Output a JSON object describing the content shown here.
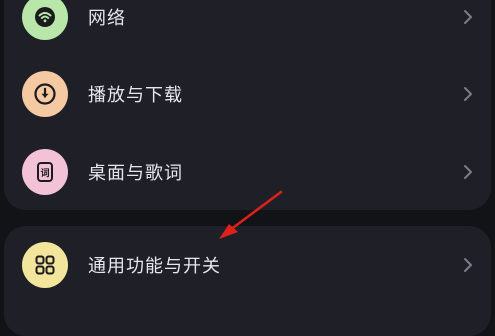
{
  "colors": {
    "background": "#121317",
    "card": "#1f2027",
    "text": "#e6e7ec",
    "chevron": "#7b7d86",
    "icon_network_bg": "#b9e7a9",
    "icon_download_bg": "#f5c9a1",
    "icon_desktop_lyrics_bg": "#f3c2d7",
    "icon_general_bg": "#f3e59b",
    "icon_glyph": "#1b1b1f",
    "annotation_arrow": "#e0211b"
  },
  "settings": {
    "group1": [
      {
        "label": "网络",
        "icon": "wifi-icon"
      },
      {
        "label": "播放与下载",
        "icon": "download-icon"
      },
      {
        "label": "桌面与歌词",
        "icon": "lyrics-icon"
      }
    ],
    "group2": [
      {
        "label": "通用功能与开关",
        "icon": "grid-icon"
      }
    ]
  }
}
